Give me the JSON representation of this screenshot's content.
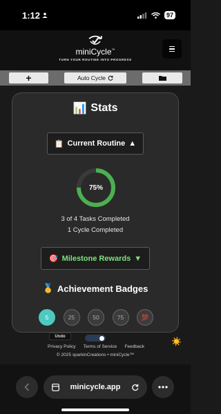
{
  "status_bar": {
    "time": "1:12",
    "battery": "97"
  },
  "header": {
    "app_name": "miniCycle",
    "trademark": "™",
    "tagline": "TURN YOUR ROUTINE INTO PROGRESS",
    "menu_icon": "hamburger-icon"
  },
  "toolbar": {
    "add_label": "+",
    "auto_cycle_label": "Auto Cycle",
    "auto_cycle_icon": "refresh-icon",
    "folder_icon": "folder-icon"
  },
  "stats": {
    "title": "Stats",
    "title_icon": "📊",
    "routine_label": "Current Routine",
    "routine_icon": "📋",
    "routine_toggle": "▲",
    "progress_label": "75%",
    "progress": 0.75,
    "tasks_completed": "3 of 4 Tasks Completed",
    "cycles_completed": "1 Cycle Completed",
    "milestone_label": "Milestone Rewards",
    "milestone_icon": "🎯",
    "milestone_toggle": "▼",
    "badges_title": "Achievement Badges",
    "badges_icon": "🥇",
    "badges": [
      {
        "label": "5",
        "earned": true
      },
      {
        "label": "25",
        "earned": false
      },
      {
        "label": "50",
        "earned": false
      },
      {
        "label": "75",
        "earned": false
      },
      {
        "label": "💯",
        "earned": false
      }
    ]
  },
  "footer": {
    "undo_label": "Undo",
    "links": [
      "Privacy Policy",
      "Terms of Service",
      "Feedback"
    ],
    "copyright": "© 2025 sparkinCreations • miniCycle™",
    "theme_icon": "☀️"
  },
  "browser": {
    "url": "minicycle.app",
    "back_icon": "chevron-left-icon",
    "reload_icon": "reload-icon",
    "more_icon": "more-icon"
  },
  "colors": {
    "accent_green": "#4caf50",
    "badge_earned": "#4ec9c0",
    "milestone_text": "#7ee07e"
  }
}
